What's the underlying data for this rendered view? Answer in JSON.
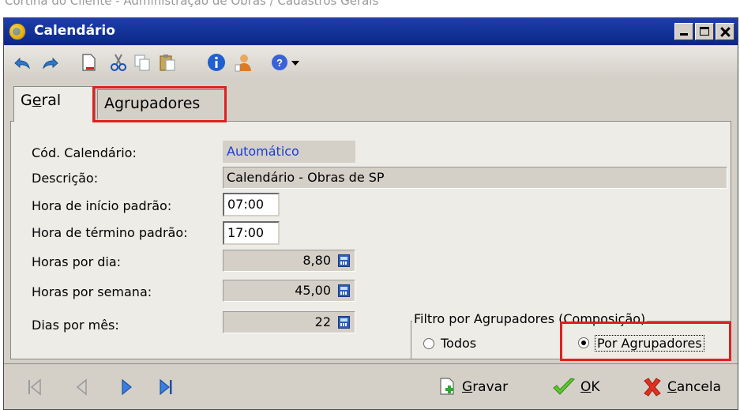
{
  "caption": "Cortina do Cliente - Administração de Obras / Cadastros Gerais",
  "window": {
    "title": "Calendário"
  },
  "toolbar": {
    "icons": [
      "undo-icon",
      "redo-icon",
      "new-document-icon",
      "cut-icon",
      "copy-icon",
      "paste-icon",
      "info-icon",
      "user-icon",
      "help-icon",
      "dropdown-arrow-icon"
    ]
  },
  "tabs": {
    "geral_pre": "G",
    "geral_mnemonic": "e",
    "geral_post": "ral",
    "agrupadores": "Agrupadores"
  },
  "form": {
    "cod_label": "Cód. Calendário:",
    "cod_value": "Automático",
    "desc_label": "Descrição:",
    "desc_value": "Calendário - Obras de SP",
    "hora_inicio_label": "Hora de início padrão:",
    "hora_inicio_value": "07:00",
    "hora_termino_label": "Hora de término padrão:",
    "hora_termino_value": "17:00",
    "horas_dia_label": "Horas por dia:",
    "horas_dia_value": "8,80",
    "horas_semana_label": "Horas por semana:",
    "horas_semana_value": "45,00",
    "dias_mes_label": "Dias por mês:",
    "dias_mes_value": "22"
  },
  "filter": {
    "legend": "Filtro por Agrupadores (Composição)",
    "option_todos": "Todos",
    "option_por_agrupadores": "Por Agrupadores",
    "selected": "Por Agrupadores"
  },
  "footer": {
    "gravar_mnemonic": "G",
    "gravar_rest": "ravar",
    "ok_mnemonic": "O",
    "ok_rest": "K",
    "cancela_mnemonic": "C",
    "cancela_rest": "ancela"
  },
  "colors": {
    "title_bar": "#0b2687",
    "highlight": "#e02020",
    "auto_text": "#1a3fd6"
  }
}
